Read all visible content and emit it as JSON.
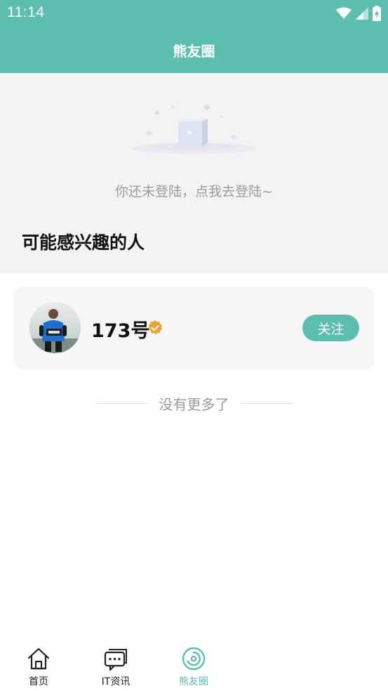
{
  "status_bar": {
    "time": "11:14"
  },
  "header": {
    "title": "熊友圈"
  },
  "empty_state": {
    "login_prompt": "你还未登陆，点我去登陆~"
  },
  "recommend": {
    "title": "可能感兴趣的人",
    "users": [
      {
        "name": "173号",
        "verified": true,
        "follow_label": "关注"
      }
    ]
  },
  "list_footer": {
    "no_more_text": "没有更多了"
  },
  "bottom_nav": {
    "items": [
      {
        "label": "首页",
        "icon": "home-icon",
        "active": false
      },
      {
        "label": "IT资讯",
        "icon": "chat-icon",
        "active": false
      },
      {
        "label": "熊友圈",
        "icon": "circle-feed-icon",
        "active": true
      }
    ]
  },
  "colors": {
    "primary": "#5bbeae",
    "badge": "#f0a030",
    "background_gray": "#f3f3f3",
    "muted_text": "#9a9a9a"
  }
}
